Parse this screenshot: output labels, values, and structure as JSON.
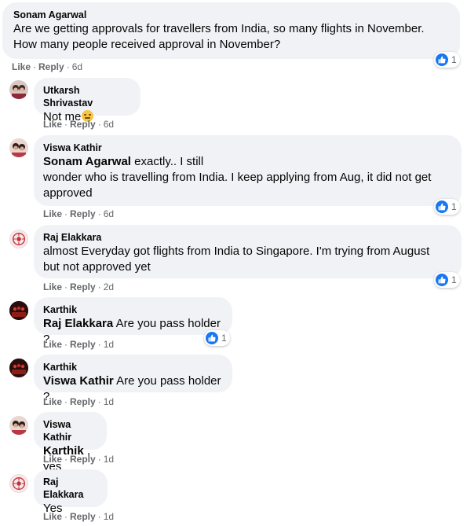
{
  "actions": {
    "like": "Like",
    "reply": "Reply",
    "sep": "·"
  },
  "comments": [
    {
      "author": "Sonam Agarwal",
      "line1": "Are we getting approvals for travellers from India, so many flights in November.",
      "line2": "How many people received approval in November?",
      "time": "6d",
      "reactions": "1"
    },
    {
      "author": "Utkarsh Shrivastav",
      "text": "Not me",
      "emoji": "smiling-face",
      "time": "6d"
    },
    {
      "author": "Viswa Kathir",
      "mention": "Sonam Agarwal",
      "line1": " exactly.. I still",
      "line2": "wonder who is travelling from India. I keep applying from Aug, it did not get",
      "line3": "approved",
      "time": "6d",
      "reactions": "1"
    },
    {
      "author": "Raj Elakkara",
      "line1": "almost Everyday got flights from India to Singapore. I'm trying from August",
      "line2": "but not approved yet",
      "time": "2d",
      "reactions": "1"
    },
    {
      "author": "Karthik",
      "mention": "Raj Elakkara",
      "text": " Are you pass holder ?",
      "time": "1d",
      "reactions": "1"
    },
    {
      "author": "Karthik",
      "mention": "Viswa Kathir",
      "text": " Are you pass holder ?",
      "time": "1d"
    },
    {
      "author": "Viswa Kathir",
      "mention": "Karthik",
      "text": " , yes",
      "time": "1d"
    },
    {
      "author": "Raj Elakkara",
      "text": "Yes",
      "time": "1d"
    }
  ],
  "colors": {
    "bubble": "#f0f2f5",
    "meta": "#65676b",
    "like": "#1877f2"
  }
}
